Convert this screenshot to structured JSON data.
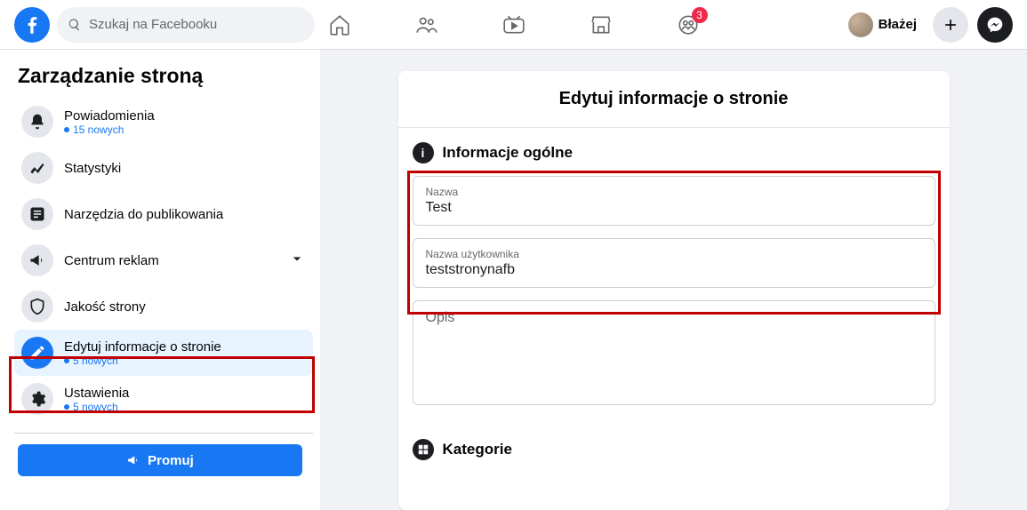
{
  "header": {
    "search_placeholder": "Szukaj na Facebooku",
    "groups_badge": "3",
    "profile_name": "Błażej"
  },
  "sidebar": {
    "title": "Zarządzanie stroną",
    "items": [
      {
        "label": "Powiadomienia",
        "sub": "15 nowych"
      },
      {
        "label": "Statystyki"
      },
      {
        "label": "Narzędzia do publikowania"
      },
      {
        "label": "Centrum reklam"
      },
      {
        "label": "Jakość strony"
      },
      {
        "label": "Edytuj informacje o stronie",
        "sub": "5 nowych"
      },
      {
        "label": "Ustawienia",
        "sub": "5 nowych"
      }
    ],
    "promote": "Promuj"
  },
  "panel": {
    "title": "Edytuj informacje o stronie",
    "general": {
      "heading": "Informacje ogólne",
      "name_label": "Nazwa",
      "name_value": "Test",
      "username_label": "Nazwa użytkownika",
      "username_value": "teststronynafb",
      "description_label": "Opis"
    },
    "categories": {
      "heading": "Kategorie"
    }
  }
}
